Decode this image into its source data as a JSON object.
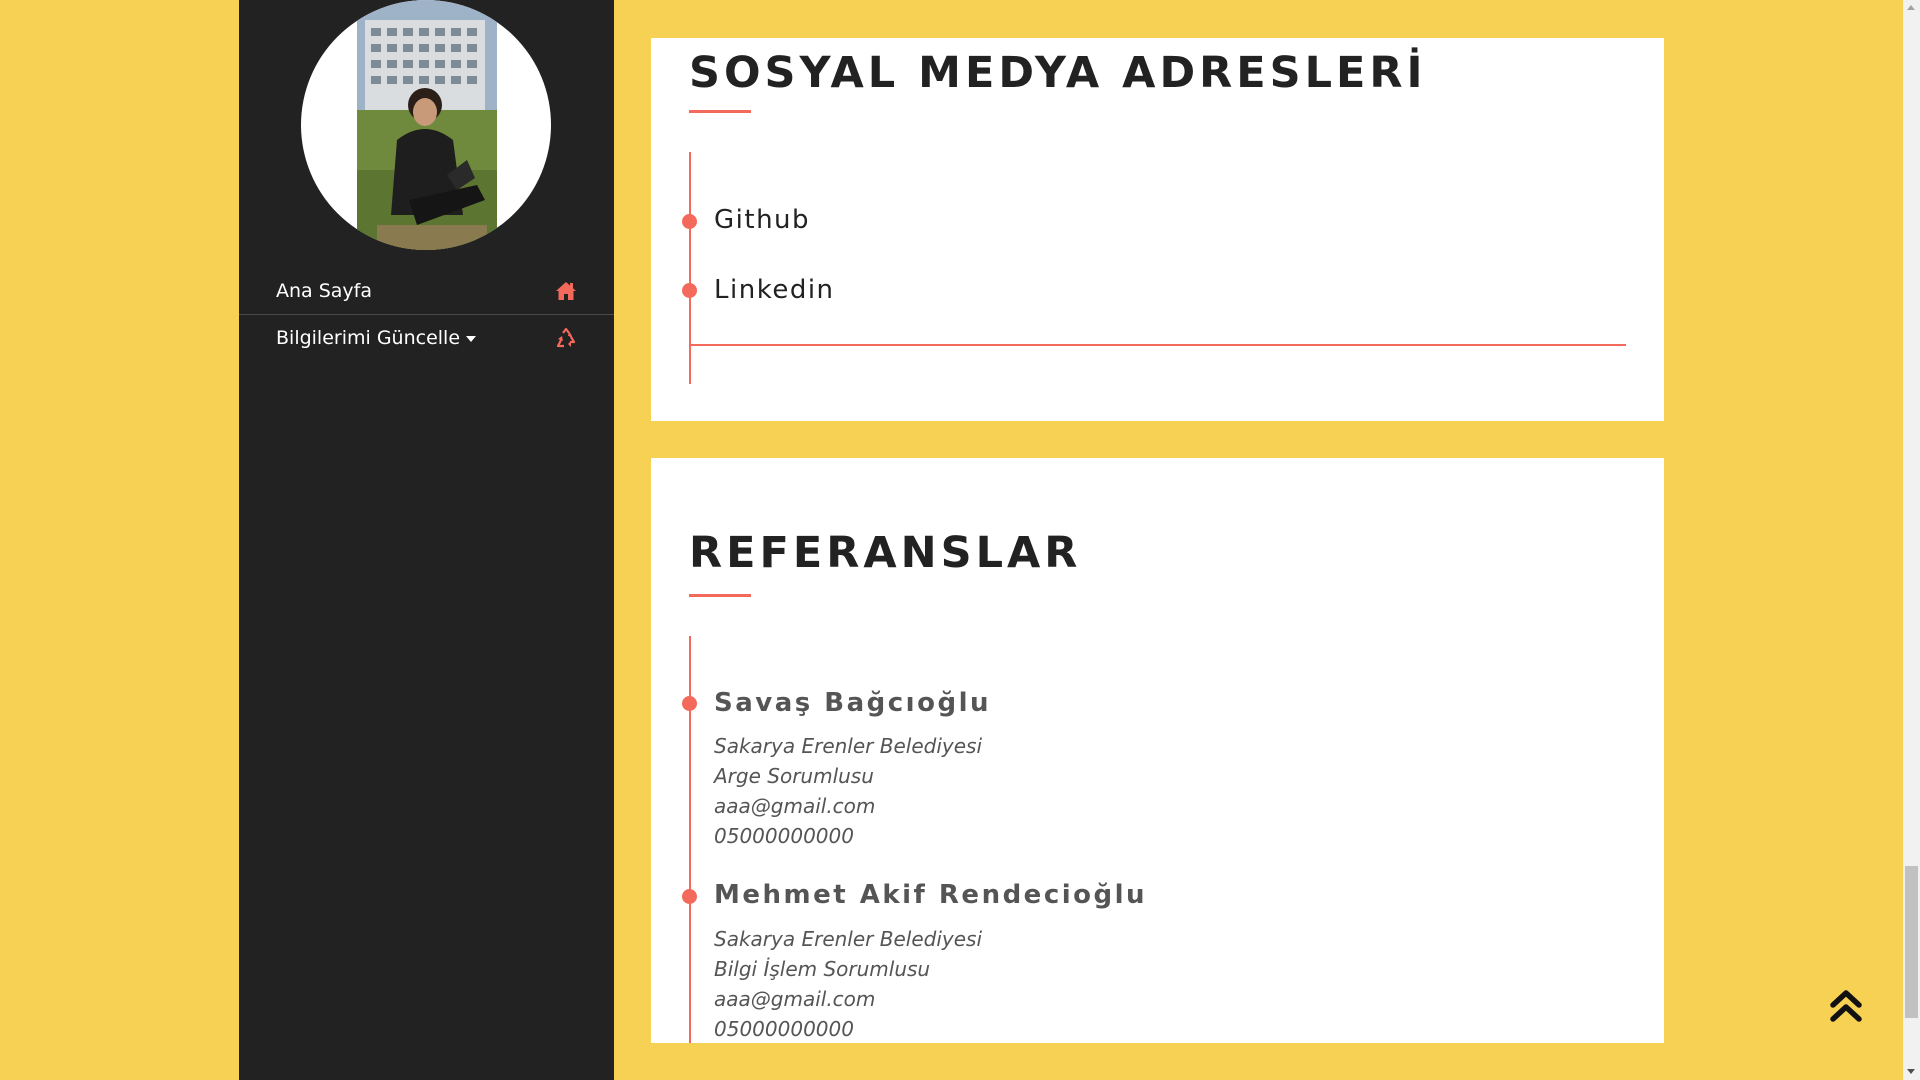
{
  "sidebar": {
    "nav": [
      {
        "label": "Ana Sayfa",
        "icon": "home-icon"
      },
      {
        "label": "Bilgilerimi Güncelle",
        "icon": "recycle-icon",
        "dropdown": true
      }
    ]
  },
  "social": {
    "title": "SOSYAL MEDYA ADRESLERİ",
    "links": [
      {
        "label": "Github"
      },
      {
        "label": "Linkedin"
      }
    ]
  },
  "references": {
    "title": "REFERANSLAR",
    "items": [
      {
        "name": "Savaş Bağcıoğlu",
        "organization": "Sakarya Erenler Belediyesi",
        "role": "Arge Sorumlusu",
        "email": "aaa@gmail.com",
        "phone": "05000000000"
      },
      {
        "name": "Mehmet Akif Rendecioğlu",
        "organization": "Sakarya Erenler Belediyesi",
        "role": "Bilgi İşlem Sorumlusu",
        "email": "aaa@gmail.com",
        "phone": "05000000000"
      }
    ]
  },
  "colors": {
    "background": "#f7d154",
    "sidebar": "#222222",
    "accent": "#f3695b",
    "card": "#ffffff"
  }
}
